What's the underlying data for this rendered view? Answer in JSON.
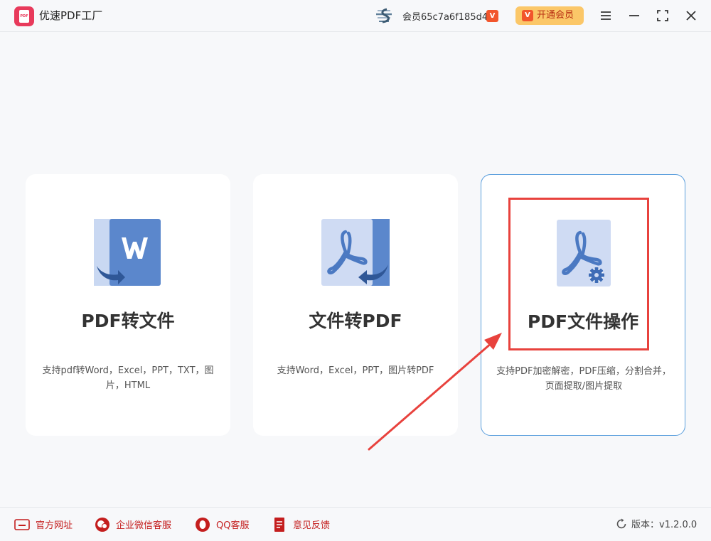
{
  "app": {
    "title": "优速PDF工厂",
    "logo_text": "PDF"
  },
  "header": {
    "member_label": "会员65c7a6f185d4",
    "vip_badge": "V",
    "open_vip_label": "开通会员"
  },
  "cards": [
    {
      "title": "PDF转文件",
      "desc": "支持pdf转Word，Excel，PPT，TXT，图片，HTML",
      "icon": "pdf-to-word-icon"
    },
    {
      "title": "文件转PDF",
      "desc": "支持Word，Excel，PPT，图片转PDF",
      "icon": "file-to-pdf-icon"
    },
    {
      "title": "PDF文件操作",
      "desc": "支持PDF加密解密，PDF压缩，分割合并，页面提取/图片提取",
      "icon": "pdf-settings-icon"
    }
  ],
  "footer": {
    "website": "官方网址",
    "wechat": "企业微信客服",
    "qq": "QQ客服",
    "feedback": "意见反馈",
    "version": "版本：v1.2.0.0"
  },
  "colors": {
    "accent": "#5b9fdd",
    "brand": "#e83a5b",
    "annotation": "#e8423d",
    "link": "#c41e1e"
  }
}
